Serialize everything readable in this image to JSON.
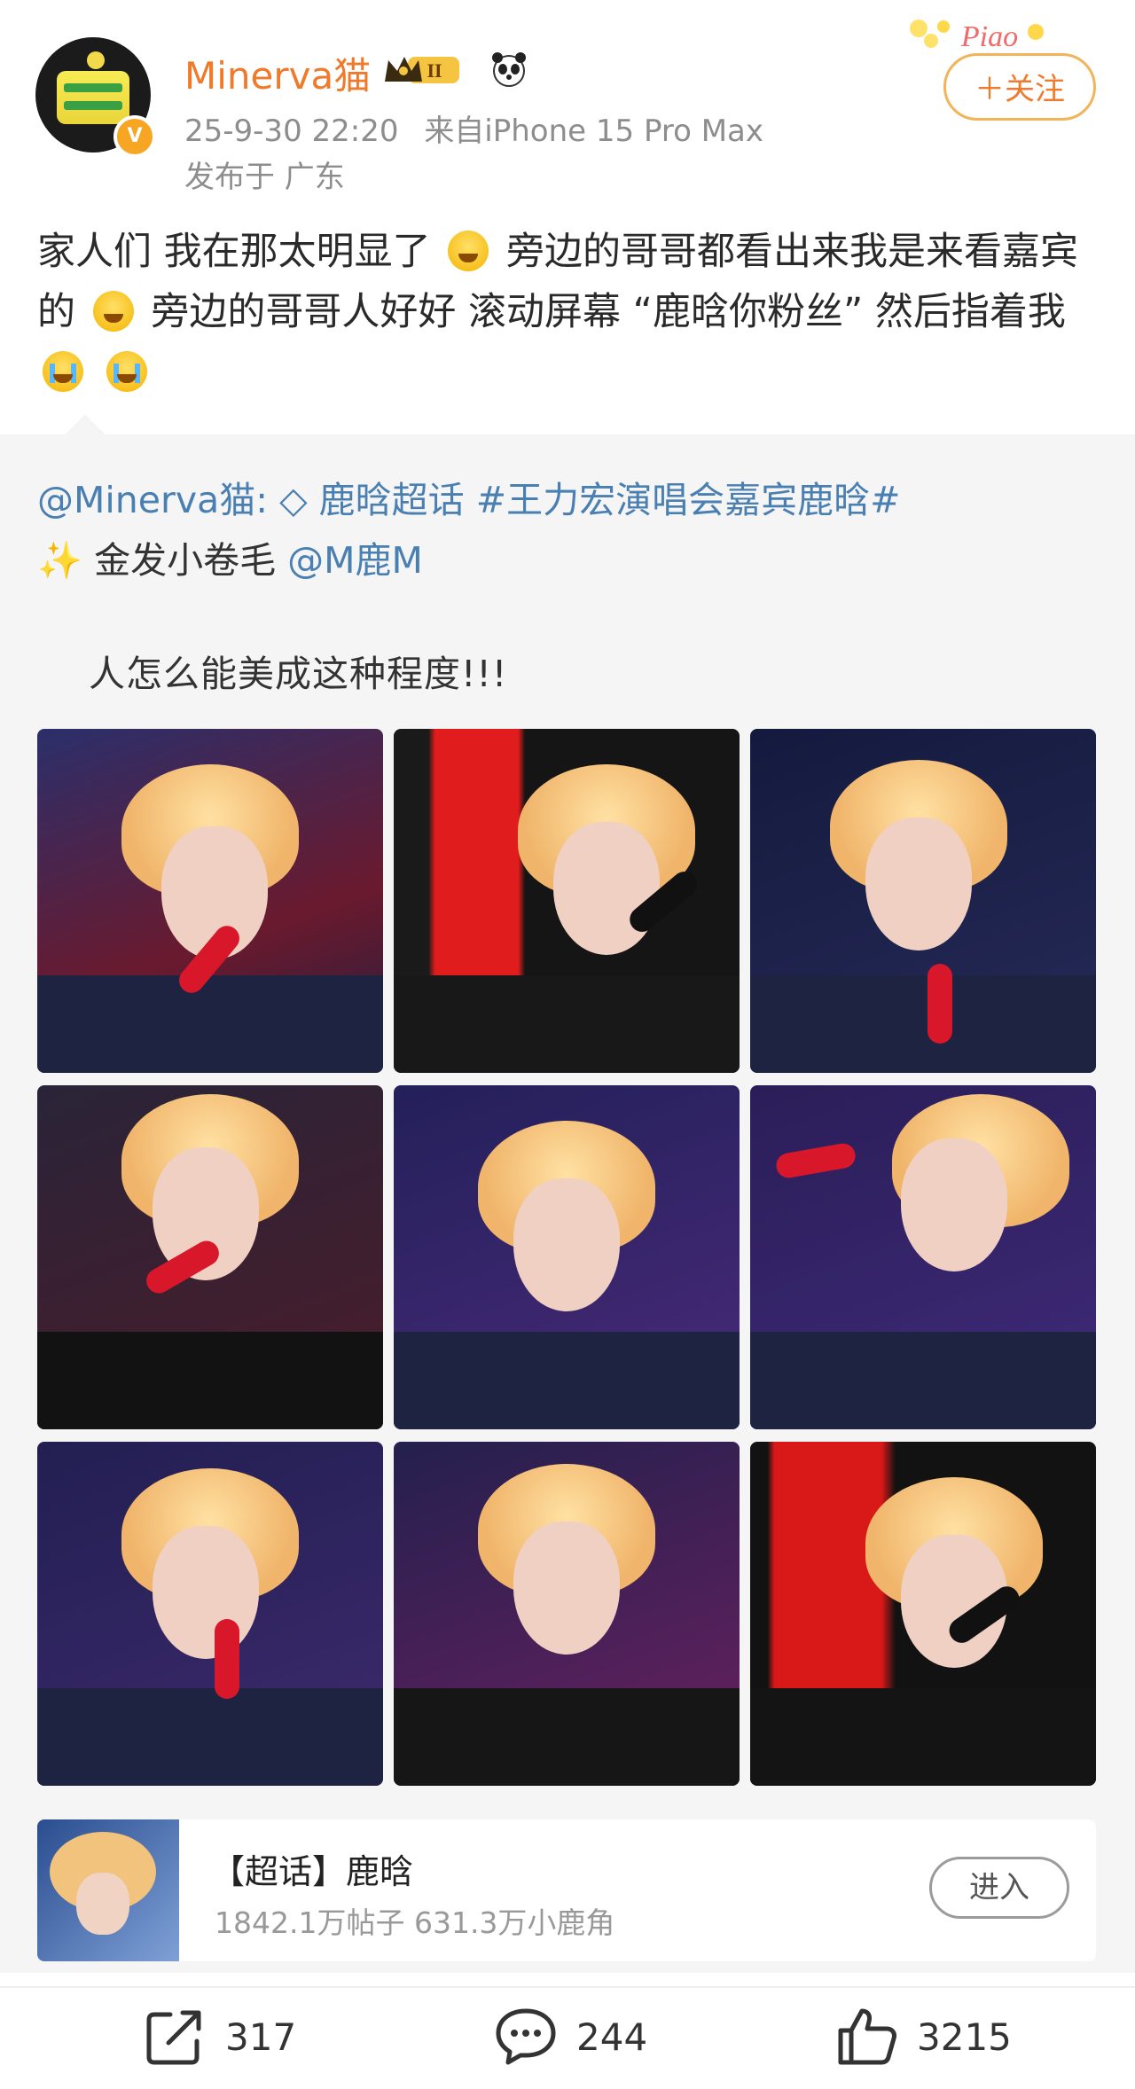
{
  "post": {
    "author": {
      "name": "Minerva猫",
      "verified_badge": "V",
      "level_badge": "II"
    },
    "timestamp": "25-9-30 22:20",
    "source": "来自iPhone 15 Pro Max",
    "location": "发布于 广东",
    "follow_label": "＋关注",
    "deco_text": "Piao",
    "body_parts": [
      "家人们 我在那太明显了",
      "旁边的哥哥都看出来我是来看嘉宾的",
      "旁边的哥哥人好好 滚动屏幕 “鹿晗你粉丝” 然后指着我"
    ]
  },
  "repost": {
    "author_mention": "@Minerva猫:",
    "gem_icon": "◇",
    "topic1": "鹿晗超话",
    "hashtag": "#王力宏演唱会嘉宾鹿晗#",
    "sparkle": "✨",
    "line2_text": "金发小卷毛 ",
    "line2_mention": "@M鹿M",
    "line3": "人怎么能美成这种程度!!!"
  },
  "supertopic": {
    "title": "【超话】鹿晗",
    "stats": "1842.1万帖子 631.3万小鹿角",
    "enter_label": "进入"
  },
  "actions": {
    "repost_count": "317",
    "comment_count": "244",
    "like_count": "3215"
  },
  "colors": {
    "username": "#f07a2c",
    "link": "#4a7fb2",
    "meta": "#8d8d8d"
  }
}
